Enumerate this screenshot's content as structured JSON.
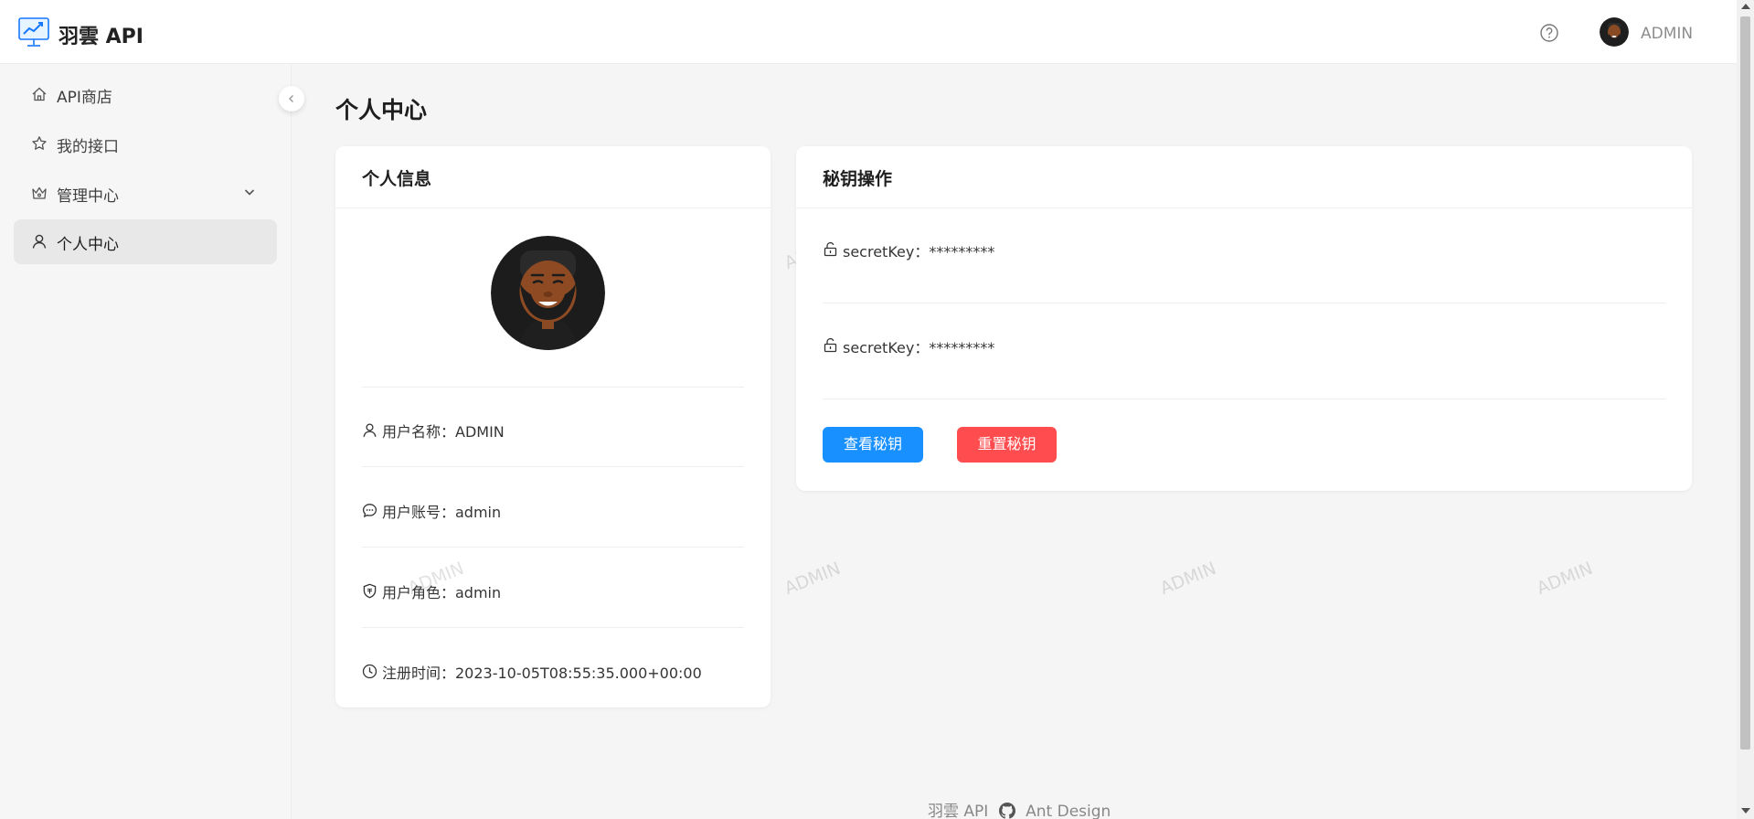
{
  "header": {
    "brand": "羽雲 API",
    "logo_icon": "monitor-chart-icon",
    "help_icon": "question-circle-icon",
    "username": "ADMIN"
  },
  "sidebar": {
    "items": [
      {
        "label": "API商店",
        "icon": "home-icon"
      },
      {
        "label": "我的接口",
        "icon": "star-icon"
      },
      {
        "label": "管理中心",
        "icon": "crown-icon",
        "expandable": true
      },
      {
        "label": "个人中心",
        "icon": "user-icon",
        "active": true
      }
    ],
    "collapse_icon": "chevron-left-icon"
  },
  "page": {
    "title": "个人中心"
  },
  "info_card": {
    "title": "个人信息",
    "rows": [
      {
        "icon": "user-icon",
        "text": "用户名称：ADMIN"
      },
      {
        "icon": "comment-icon",
        "text": "用户账号：admin"
      },
      {
        "icon": "shield-icon",
        "text": "用户角色：admin"
      },
      {
        "icon": "clock-icon",
        "text": "注册时间：2023-10-05T08:55:35.000+00:00"
      }
    ]
  },
  "key_card": {
    "title": "秘钥操作",
    "rows": [
      {
        "icon": "unlock-icon",
        "text": "secretKey：*********"
      },
      {
        "icon": "unlock-icon",
        "text": "secretKey：*********"
      }
    ],
    "view_label": "查看秘钥",
    "reset_label": "重置秘钥",
    "view_color": "#1890ff",
    "reset_color": "#ff4d4f"
  },
  "watermark": "ADMIN",
  "footer": {
    "brand": "羽雲 API",
    "github_icon": "github-icon",
    "link": "Ant Design"
  }
}
